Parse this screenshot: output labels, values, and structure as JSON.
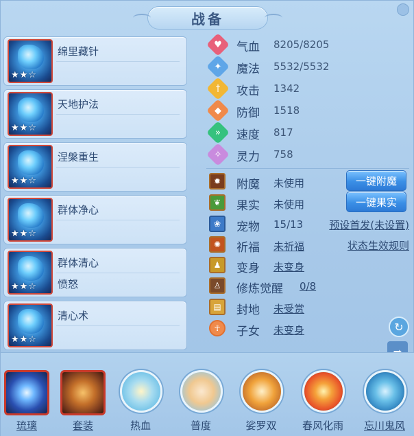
{
  "window": {
    "title": "战备"
  },
  "skills": [
    {
      "name": "绵里藏针",
      "sub": "",
      "stars": "★★☆"
    },
    {
      "name": "天地护法",
      "sub": "",
      "stars": "★★☆"
    },
    {
      "name": "涅槃重生",
      "sub": "",
      "stars": "★★☆"
    },
    {
      "name": "群体净心",
      "sub": "",
      "stars": "★★☆"
    },
    {
      "name": "群体清心",
      "sub": "愤怒",
      "stars": "★★☆"
    },
    {
      "name": "清心术",
      "sub": "",
      "stars": "★★☆"
    }
  ],
  "stats": [
    {
      "label": "气血",
      "value": "8205/8205",
      "icon": "heart-icon",
      "color": "#e8607a"
    },
    {
      "label": "魔法",
      "value": "5532/5532",
      "icon": "mana-icon",
      "color": "#5fa6e8"
    },
    {
      "label": "攻击",
      "value": "1342",
      "icon": "sword-icon",
      "color": "#f2b735"
    },
    {
      "label": "防御",
      "value": "1518",
      "icon": "shield-icon",
      "color": "#f08a4b"
    },
    {
      "label": "速度",
      "value": "817",
      "icon": "speed-icon",
      "color": "#35c27e"
    },
    {
      "label": "灵力",
      "value": "758",
      "icon": "spirit-icon",
      "color": "#c98bde"
    }
  ],
  "equip": [
    {
      "label": "附魔",
      "value": "未使用",
      "button": "一键附魔",
      "icon": "enchant-icon",
      "color": "#7a3d1e"
    },
    {
      "label": "果实",
      "value": "未使用",
      "button": "一键果实",
      "icon": "fruit-icon",
      "color": "#4a9a3a"
    },
    {
      "label": "宠物",
      "value": "15/13",
      "link": "预设首发(未设置)",
      "icon": "paw-icon",
      "color": "#3d7ac8"
    },
    {
      "label": "祈福",
      "value": "未祈福",
      "link": "状态生效规则",
      "icon": "blessing-icon",
      "color": "#c2541e"
    },
    {
      "label": "变身",
      "value": "未变身",
      "icon": "transform-icon",
      "color": "#c89a2a"
    },
    {
      "label": "修炼觉醒",
      "value": "0/8",
      "icon": "cultivate-icon",
      "color": "#7a4a2a"
    },
    {
      "label": "封地",
      "value": "未受赏",
      "icon": "fief-icon",
      "color": "#d8a43a"
    },
    {
      "label": "子女",
      "value": "未变身",
      "icon": "child-icon",
      "color": "#f08a4b"
    }
  ],
  "bottom": [
    {
      "label": "琉璃",
      "type": "square",
      "icon": "glaze-orb-icon",
      "color": "#2a4fb0"
    },
    {
      "label": "套装",
      "type": "square",
      "icon": "armor-set-icon",
      "color": "#7a3a1e"
    },
    {
      "label": "热血",
      "type": "circle",
      "icon": "hot-blood-icon",
      "color": "#6bbfe6"
    },
    {
      "label": "普度",
      "type": "circle",
      "icon": "salvation-icon",
      "color": "#f0c890"
    },
    {
      "label": "娑罗双",
      "type": "circle",
      "icon": "sala-icon",
      "color": "#f0a23a"
    },
    {
      "label": "春风化雨",
      "type": "circle",
      "icon": "spring-rain-icon",
      "color": "#e8542a"
    },
    {
      "label": "忘川鬼风",
      "type": "circle",
      "icon": "ghost-wind-icon",
      "color": "#3a8fc8"
    }
  ]
}
